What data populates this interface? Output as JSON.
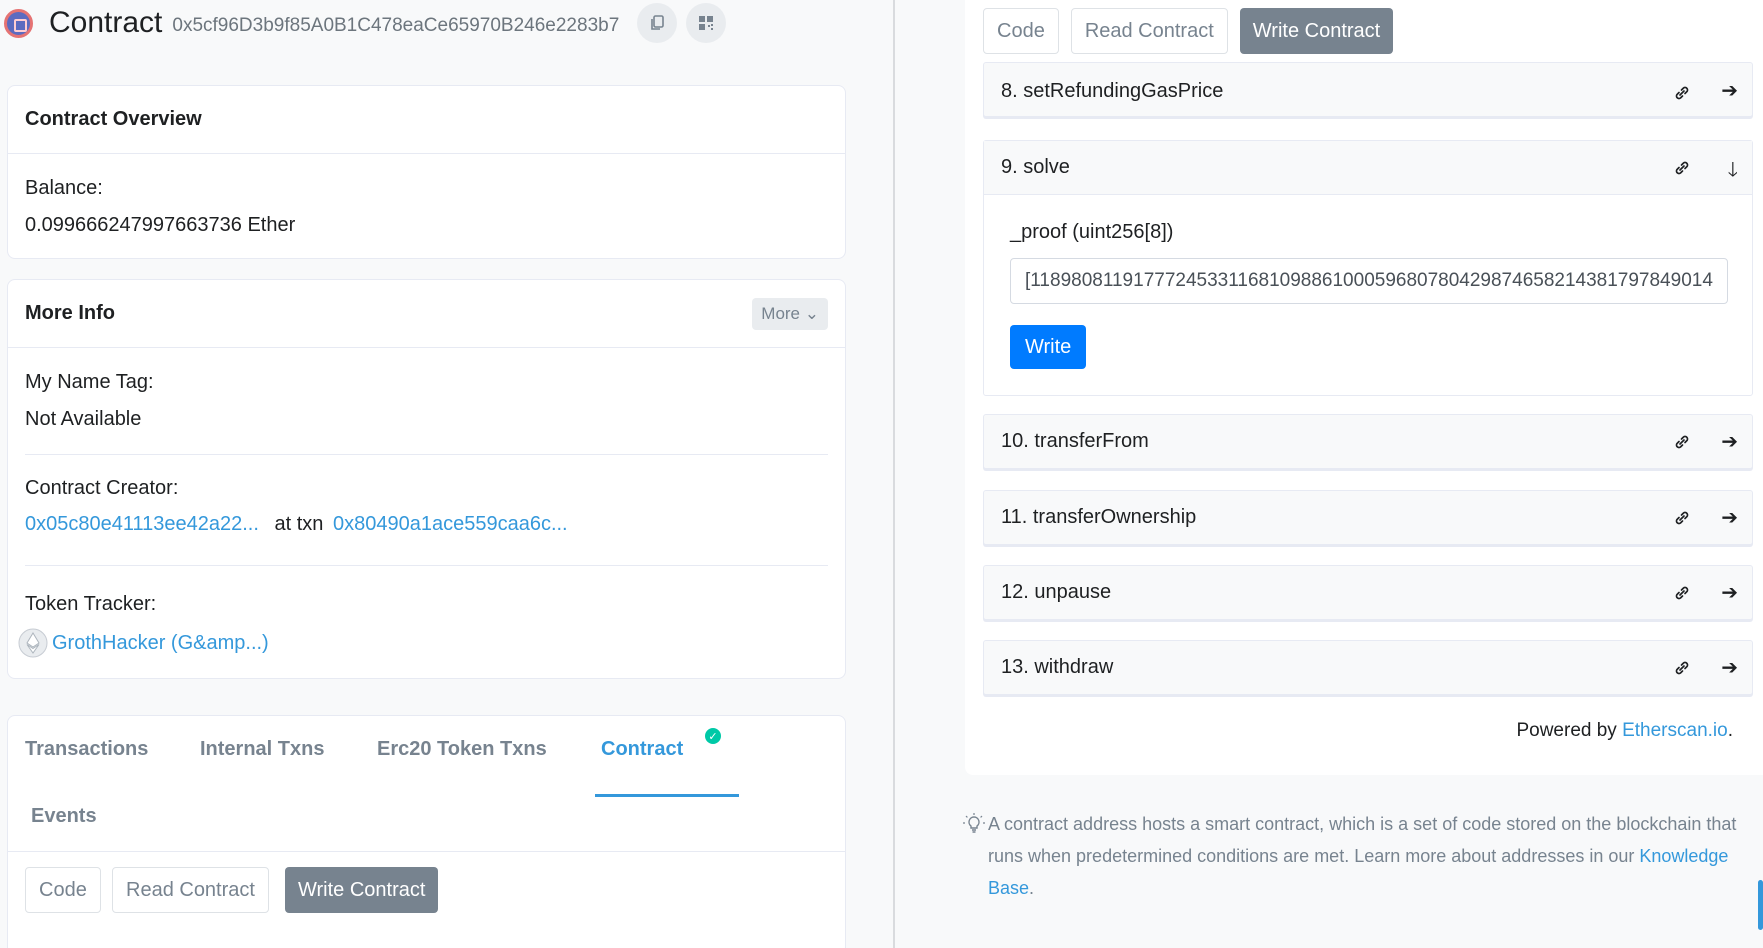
{
  "header": {
    "title": "Contract",
    "address": "0x5cf96D3b9f85A0B1C478eaCe65970B246e2283b7"
  },
  "overview": {
    "title": "Contract Overview",
    "balance_label": "Balance:",
    "balance_value": "0.099666247997663736 Ether"
  },
  "more_info": {
    "title": "More Info",
    "more_button": "More",
    "name_tag_label": "My Name Tag:",
    "name_tag_value": "Not Available",
    "creator_label": "Contract Creator:",
    "creator_address": "0x05c80e41113ee42a22...",
    "at_txn": "at txn",
    "creator_txn": "0x80490a1ace559caa6c...",
    "token_label": "Token Tracker:",
    "token_name": "GrothHacker (G&amp...)"
  },
  "tabs": {
    "items": [
      "Transactions",
      "Internal Txns",
      "Erc20 Token Txns",
      "Contract",
      "Events"
    ],
    "active": "Contract"
  },
  "sub_buttons": {
    "code": "Code",
    "read": "Read Contract",
    "write": "Write Contract"
  },
  "functions": {
    "items": [
      {
        "label": "8. setRefundingGasPrice",
        "state": "collapsed"
      },
      {
        "label": "9. solve",
        "state": "expanded"
      },
      {
        "label": "10. transferFrom",
        "state": "collapsed"
      },
      {
        "label": "11. transferOwnership",
        "state": "collapsed"
      },
      {
        "label": "12. unpause",
        "state": "collapsed"
      },
      {
        "label": "13. withdraw",
        "state": "collapsed"
      }
    ],
    "solve_param_label": "_proof (uint256[8])",
    "solve_param_value": "[11898081191777245331168109886100059680780429874658214381797849014",
    "write_button": "Write"
  },
  "footer": {
    "powered_prefix": "Powered by ",
    "powered_link": "Etherscan.io",
    "powered_suffix": ".",
    "note_text": "A contract address hosts a smart contract, which is a set of code stored on the blockchain that runs when predetermined conditions are met. Learn more about addresses in our ",
    "note_link": "Knowledge Base",
    "note_suffix": "."
  },
  "colors": {
    "link": "#3498db",
    "primary_button": "#007bff",
    "secondary_button": "#77838f",
    "verified_check": "#00c9a7"
  }
}
